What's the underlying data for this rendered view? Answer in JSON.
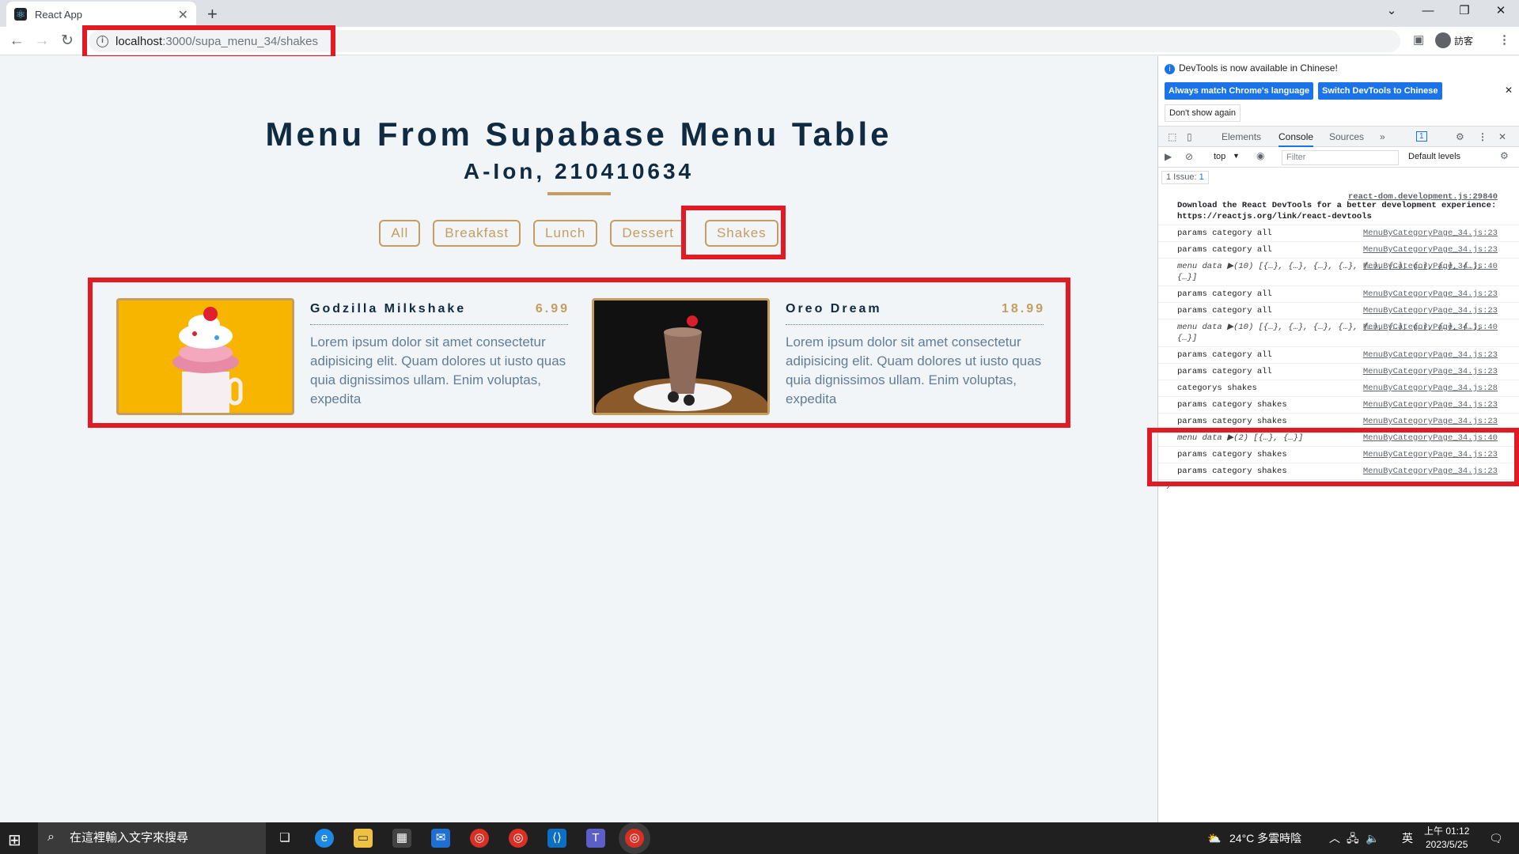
{
  "browser": {
    "tab_title": "React App",
    "tab_close": "✕",
    "new_tab": "+",
    "url_host": "localhost",
    "url_path": ":3000/supa_menu_34/shakes",
    "profile_label": "訪客",
    "win_min": "—",
    "win_max": "❐",
    "win_close": "✕",
    "dropdown": "⌄"
  },
  "page": {
    "title": "Menu From Supabase Menu Table",
    "subtitle": "A-Ion, 210410634",
    "filters": [
      "All",
      "Breakfast",
      "Lunch",
      "Dessert",
      "Shakes"
    ],
    "active_filter": "Shakes",
    "accent_color": "#c59d5f",
    "items": [
      {
        "name": "Godzilla Milkshake",
        "price": "6.99",
        "desc": "Lorem ipsum dolor sit amet consectetur adipisicing elit. Quam dolores ut iusto quas quia dignissimos ullam. Enim voluptas, expedita"
      },
      {
        "name": "Oreo Dream",
        "price": "18.99",
        "desc": "Lorem ipsum dolor sit amet consectetur adipisicing elit. Quam dolores ut iusto quas quia dignissimos ullam. Enim voluptas, expedita"
      }
    ]
  },
  "devtools": {
    "notice": "DevTools is now available in Chinese!",
    "btn_match": "Always match Chrome's language",
    "btn_switch": "Switch DevTools to Chinese",
    "btn_dont": "Don't show again",
    "tabs": [
      "Elements",
      "Console",
      "Sources"
    ],
    "active_tab": "Console",
    "issues_badge": "1",
    "context": "top",
    "filter_placeholder": "Filter",
    "levels": "Default levels",
    "issues_label": "1 Issue:",
    "issues_count": "1",
    "log": [
      {
        "text": "Download the React DevTools for a better development experience: https://reactjs.org/link/react-devtools",
        "src": "react-dom.development.js:29840"
      },
      {
        "text": "params category all",
        "src": "MenuByCategoryPage_34.js:23"
      },
      {
        "text": "params category all",
        "src": "MenuByCategoryPage_34.js:23"
      },
      {
        "text": "menu data ▶(10) [{…}, {…}, {…}, {…}, {…}, {…}, {…}, {…}, {…}, {…}]",
        "src": "MenuByCategoryPage_34.js:40"
      },
      {
        "text": "params category all",
        "src": "MenuByCategoryPage_34.js:23"
      },
      {
        "text": "params category all",
        "src": "MenuByCategoryPage_34.js:23"
      },
      {
        "text": "menu data ▶(10) [{…}, {…}, {…}, {…}, {…}, {…}, {…}, {…}, {…}, {…}]",
        "src": "MenuByCategoryPage_34.js:40"
      },
      {
        "text": "params category all",
        "src": "MenuByCategoryPage_34.js:23"
      },
      {
        "text": "params category all",
        "src": "MenuByCategoryPage_34.js:23"
      },
      {
        "text": "categorys shakes",
        "src": "MenuByCategoryPage_34.js:28"
      },
      {
        "text": "params category shakes",
        "src": "MenuByCategoryPage_34.js:23"
      },
      {
        "text": "params category shakes",
        "src": "MenuByCategoryPage_34.js:23"
      },
      {
        "text": "menu data ▶(2) [{…}, {…}]",
        "src": "MenuByCategoryPage_34.js:40"
      },
      {
        "text": "params category shakes",
        "src": "MenuByCategoryPage_34.js:23"
      },
      {
        "text": "params category shakes",
        "src": "MenuByCategoryPage_34.js:23"
      }
    ],
    "prompt": "›"
  },
  "taskbar": {
    "search_placeholder": "在這裡輸入文字來搜尋",
    "weather": "24°C 多雲時陰",
    "ime": "英",
    "time": "上午 01:12",
    "date": "2023/5/25"
  },
  "highlight_color": "#e21a24"
}
